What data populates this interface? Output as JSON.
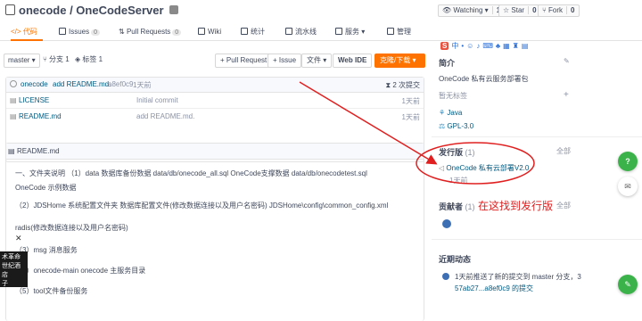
{
  "repo": {
    "owner": "onecode",
    "name": "OneCodeServer",
    "title": "onecode / OneCodeServer"
  },
  "top_buttons": [
    {
      "label": "Watching",
      "count": "1"
    },
    {
      "label": "Star",
      "count": "0"
    },
    {
      "label": "Fork",
      "count": "0"
    }
  ],
  "tabs": [
    {
      "label": "代码"
    },
    {
      "label": "Issues",
      "count": "0"
    },
    {
      "label": "Pull Requests",
      "count": "0"
    },
    {
      "label": "Wiki"
    },
    {
      "label": "统计"
    },
    {
      "label": "流水线"
    },
    {
      "label": "服务"
    },
    {
      "label": "管理"
    }
  ],
  "toolbar": {
    "branch": "master",
    "branches": "分支 1",
    "tags": "标签 1",
    "pull_request": "+ Pull Request",
    "issue": "+ Issue",
    "file": "文件",
    "webide": "Web IDE",
    "clone": "克隆/下载"
  },
  "commit": {
    "author": "onecode",
    "message": "add README.md.",
    "sha": "a8ef0c9",
    "time": "1天前",
    "count": "2 次提交"
  },
  "files": [
    {
      "name": "LICENSE",
      "commit": "Initial commit",
      "time": "1天前"
    },
    {
      "name": "README.md",
      "commit": "add README.md.",
      "time": "1天前"
    }
  ],
  "readme": {
    "title": "README.md",
    "lines": [
      "一、文件夹说明 （1）data 数据库备份数据 data/db/onecode_all.sql OneCode支撑数据 data/db/onecodetest.sql",
      "OneCode 示例数据",
      "（2）JDSHome 系统配置文件夹 数据库配置文件(修改数据连接以及用户名密码) JDSHome\\config\\common_config.xml",
      "radis(修改数据连接以及用户名密码)",
      "（3）msg 消息服务",
      "（4）onecode-main onecode 主服务目录",
      "（5）tool文件备份服务"
    ],
    "close": "✕"
  },
  "ad": {
    "line1": "术革命",
    "line2": "世纪酒店",
    "line3": "子"
  },
  "sidebar": {
    "intro_title": "简介",
    "intro_text": "OneCode 私有云服务部署包",
    "no_tags": "暂无标签",
    "lang": "Java",
    "license": "GPL-3.0",
    "release_title": "发行版",
    "release_count": "(1)",
    "release_all": "全部",
    "release_name": "OneCode 私有云部署V2.0",
    "release_time": "1天前",
    "contrib_title": "贡献者",
    "contrib_count": "(1)",
    "contrib_all": "全部",
    "annotation": "在这找到发行版",
    "activity_title": "近期动态",
    "activity_line1": "1天前推送了新的提交到 master 分支，3",
    "activity_line2": "57ab27...a8ef0c9 的提交"
  },
  "float": {
    "help": "?"
  },
  "colors": {
    "accent": "#fe7300",
    "annotation": "#e02020",
    "link": "#005980"
  }
}
